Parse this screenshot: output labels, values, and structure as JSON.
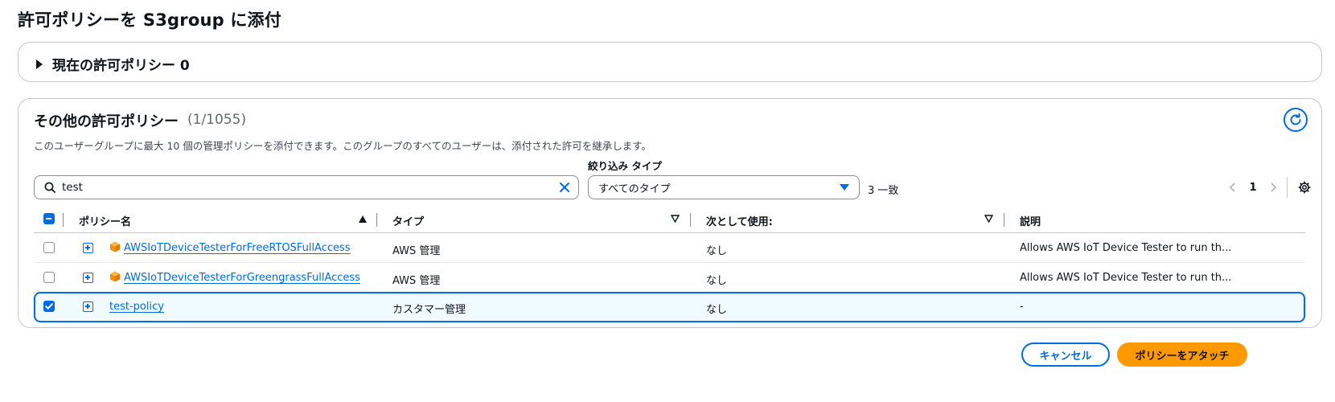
{
  "page": {
    "title": "許可ポリシーを S3group に添付"
  },
  "current_policies": {
    "label": "現在の許可ポリシー 0"
  },
  "other_policies": {
    "title": "その他の許可ポリシー",
    "count": "(1/1055)",
    "description": "このユーザーグループに最大 10 個の管理ポリシーを添付できます。このグループのすべてのユーザーは、添付された許可を継承します。"
  },
  "search": {
    "value": "test",
    "placeholder": ""
  },
  "filter": {
    "label": "絞り込み タイプ",
    "selected": "すべてのタイプ",
    "match_count": "3 一致"
  },
  "pagination": {
    "current_page": "1"
  },
  "table": {
    "columns": {
      "name": "ポリシー名",
      "type": "タイプ",
      "used_as": "次として使用:",
      "description": "説明"
    },
    "rows": [
      {
        "name": "AWSIoTDeviceTesterForFreeRTOSFullAccess",
        "type": "AWS 管理",
        "used_as": "なし",
        "description": "Allows AWS IoT Device Tester to run th...",
        "checked": false,
        "aws_icon": true
      },
      {
        "name": "AWSIoTDeviceTesterForGreengrassFullAccess",
        "type": "AWS 管理",
        "used_as": "なし",
        "description": "Allows AWS IoT Device Tester to run th...",
        "checked": false,
        "aws_icon": true
      },
      {
        "name": "test-policy",
        "type": "カスタマー管理",
        "used_as": "なし",
        "description": "-",
        "checked": true,
        "aws_icon": false
      }
    ]
  },
  "actions": {
    "cancel": "キャンセル",
    "attach": "ポリシーをアタッチ"
  },
  "colors": {
    "accent": "#006ce0",
    "primary_button": "#ff9900",
    "aws_icon": "#f29100"
  }
}
